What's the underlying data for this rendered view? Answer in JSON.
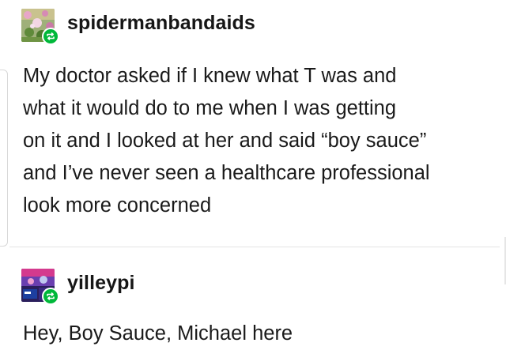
{
  "posts": [
    {
      "username": "spidermanbandaids",
      "avatar_icon": "flower-photo-avatar-icon",
      "badge_icon": "reblog-icon",
      "badge_color": "#00b83a",
      "lines": [
        "My doctor asked if I knew what T was and",
        "what it would do to me when I was getting",
        "on it and I looked at her and said “boy sauce”",
        "and I’ve never seen a healthcare professional",
        "look more concerned"
      ]
    },
    {
      "username": "yilleypi",
      "avatar_icon": "tv-show-avatar-icon",
      "badge_icon": "reblog-icon",
      "badge_color": "#00b83a",
      "lines": [
        "Hey, Boy Sauce, Michael here"
      ]
    }
  ]
}
